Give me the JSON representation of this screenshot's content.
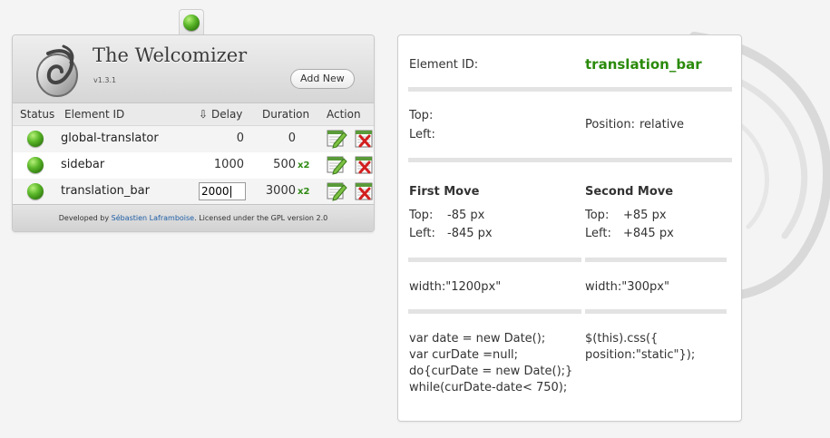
{
  "app": {
    "title": "The Welcomizer",
    "version": "v1.3.1",
    "add_new_label": "Add New"
  },
  "table": {
    "headers": {
      "status": "Status",
      "element_id": "Element ID",
      "sort_arrow": "⇩",
      "delay": "Delay",
      "duration": "Duration",
      "action": "Action"
    },
    "rows": [
      {
        "status": "active",
        "element_id": "global-translator",
        "delay": "0",
        "duration": "0",
        "multiplier": ""
      },
      {
        "status": "active",
        "element_id": "sidebar",
        "delay": "1000",
        "duration": "500",
        "multiplier": "x2"
      },
      {
        "status": "active",
        "element_id": "translation_bar",
        "delay": "2000",
        "duration": "3000",
        "multiplier": "x2"
      }
    ]
  },
  "footer": {
    "prefix": "Developed by",
    "author": "Sébastien Laframboise",
    "suffix": ". Licensed under the GPL version 2.0"
  },
  "panel": {
    "element_id_label": "Element ID:",
    "element_id_value": "translation_bar",
    "top_label": "Top:",
    "left_label": "Left:",
    "position_label": "Position:",
    "position_value": "relative",
    "first_move": {
      "title": "First Move",
      "top_label": "Top:",
      "top_value": "-85 px",
      "left_label": "Left:",
      "left_value": "-845 px",
      "css": "width:\"1200px\"",
      "js": "var date = new Date();\nvar curDate =null;\ndo{curDate = new Date();}\nwhile(curDate-date< 750);"
    },
    "second_move": {
      "title": "Second Move",
      "top_label": "Top:",
      "top_value": "+85 px",
      "left_label": "Left:",
      "left_value": "+845 px",
      "css": "width:\"300px\"",
      "js": "$(this).css({\nposition:\"static\"});"
    }
  },
  "colors": {
    "accent_green": "#2a8a0a",
    "link_blue": "#1f5fa8"
  },
  "icons": {
    "status": "green-ball-icon",
    "edit": "edit-calendar-icon",
    "delete": "delete-calendar-icon"
  }
}
